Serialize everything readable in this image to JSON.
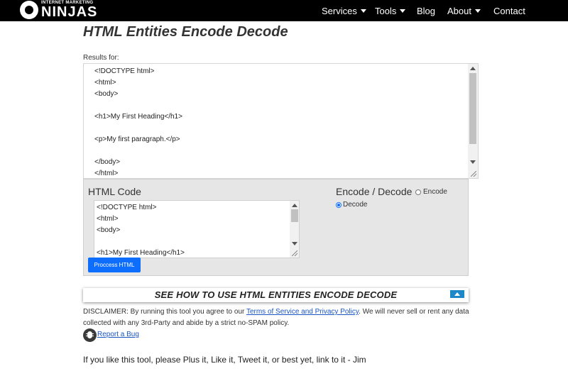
{
  "brand": {
    "tagline": "INTERNET MARKETING",
    "name": "NINJAS"
  },
  "nav": {
    "services": "Services",
    "tools": "Tools",
    "blog": "Blog",
    "about": "About",
    "contact": "Contact"
  },
  "page": {
    "title": "HTML Entities Encode Decode",
    "results_label": "Results for:"
  },
  "result_text": "<!DOCTYPE html>\n<html>\n<body>\n\n<h1>My First Heading</h1>\n\n<p>My first paragraph.</p>\n\n</body>\n</html>",
  "tool": {
    "html_code_label": "HTML Code",
    "code_value": "<!DOCTYPE html>\n<html>\n<body>\n\n<h1>My First Heading</h1>",
    "process_button": "Proccess HTML",
    "mode_label": "Encode / Decode",
    "encode_label": "Encode",
    "decode_label": "Decode",
    "selected_mode": "Decode"
  },
  "howto": {
    "text": "SEE HOW TO USE HTML ENTITIES ENCODE DECODE"
  },
  "disclaimer": {
    "prefix": "DISCLAIMER: By running this tool you agree to our ",
    "link_text": "Terms of Service and Privacy Policy",
    "suffix": ". We will never sell or rent any data collected with any 3rd-Party and abide by a strict no-SPAM policy."
  },
  "bug_link": "Report a Bug",
  "plus_line": "If you like this tool, please Plus it, Like it, Tweet it, or best yet, link to it - Jim",
  "colors": {
    "navbar": "#000000",
    "button": "#0d6efd",
    "link": "#1a55c4",
    "panel": "#e6e6e6",
    "toggle": "#1e88c8"
  }
}
